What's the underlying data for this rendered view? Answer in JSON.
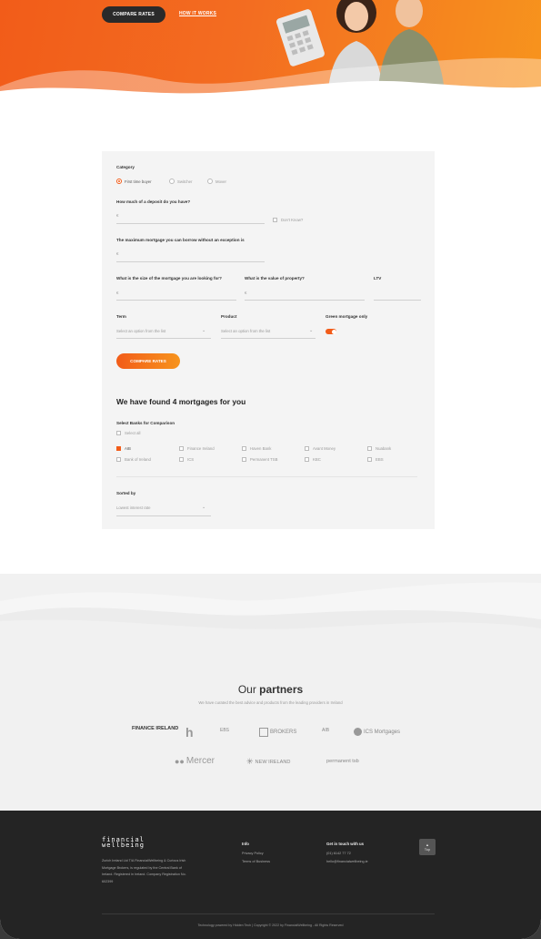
{
  "hero": {
    "compare_button": "COMPARE RATES",
    "how_link": "HOW IT WORKS"
  },
  "form": {
    "category_label": "Category",
    "categories": [
      "First time buyer",
      "Switcher",
      "Mover"
    ],
    "selected_category": "First time buyer",
    "deposit_label": "How much of a deposit do you have?",
    "deposit_value": "€",
    "dont_know_label": "Don't Know?",
    "max_mortgage_label": "The maximum mortgage you can borrow without an exception is",
    "max_mortgage_value": "€",
    "size_label": "What is the size of the mortgage you are looking for?",
    "size_value": "€",
    "property_label": "What is the value of property?",
    "property_value": "€",
    "ltv_label": "LTV",
    "term_label": "Term",
    "term_placeholder": "Select an option from the list",
    "product_label": "Product",
    "product_placeholder": "Select an option from the list",
    "green_label": "Green mortgage only",
    "green_on": true,
    "compare_button": "COMPARE RATES"
  },
  "results": {
    "found_text": "We have found 4 mortgages for you",
    "banks_label": "Select Banks for Comparison",
    "select_all": "Select all",
    "banks_row1": [
      {
        "name": "AIB",
        "checked": true
      },
      {
        "name": "Finance Ireland",
        "checked": false
      },
      {
        "name": "Haven Bank",
        "checked": false
      },
      {
        "name": "Avant Money",
        "checked": false
      },
      {
        "name": "Nuabank",
        "checked": false
      }
    ],
    "banks_row2": [
      {
        "name": "Bank of Ireland",
        "checked": false
      },
      {
        "name": "ICS",
        "checked": false
      },
      {
        "name": "Permanent TSB",
        "checked": false
      },
      {
        "name": "KBC",
        "checked": false
      },
      {
        "name": "EBS",
        "checked": false
      }
    ],
    "sorted_label": "Sorted by",
    "sorted_value": "Lowest interest rate"
  },
  "partners": {
    "title_light": "Our ",
    "title_bold": "partners",
    "subtitle": "We have curated the best advice and products from the leading providers in Ireland",
    "logos_row1": [
      "FINANCE IRELAND",
      "h",
      "EBS",
      "BROKERS",
      "AIB",
      "ICS Mortgages"
    ],
    "logos_row2": [
      "Mercer",
      "NEW IRELAND",
      "permanent tsb"
    ]
  },
  "footer": {
    "logo_line1": "financial",
    "logo_line2": "wellbeing",
    "about": "Zurich Ireland Ltd T/A FinancialWellbeing & Curious Irish Mortgage Brokers, is regulated by the Central Bank of Ireland. Registered in Ireland. Company Registration No. 602399",
    "info_head": "Info",
    "info_links": [
      "Privacy Policy",
      "Terms of Business"
    ],
    "contact_head": "Get in touch with us",
    "contact_phone": "(01) 6142 77 72",
    "contact_email": "hello@financialwellbeing.ie",
    "top_label": "Top",
    "copyright": "Technology powered by Hidden Tech | Copyright © 2022 by FinancialWellbeing - All Rights Reserved"
  },
  "colors": {
    "accent": "#f25c19",
    "accent_light": "#f7941d",
    "footer_bg": "#242424"
  }
}
